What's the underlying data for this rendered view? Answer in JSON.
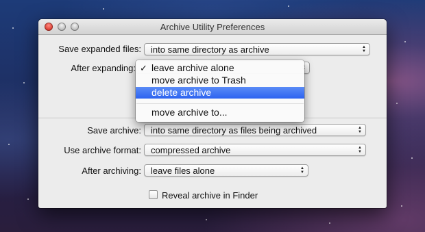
{
  "window": {
    "title": "Archive Utility Preferences"
  },
  "expand": {
    "save_expanded_label": "Save expanded files:",
    "save_expanded_value": "into same directory as archive",
    "after_expanding_label": "After expanding:"
  },
  "menu": {
    "items": [
      {
        "label": "leave archive alone",
        "checked": true,
        "highlighted": false
      },
      {
        "label": "move archive to Trash",
        "checked": false,
        "highlighted": false
      },
      {
        "label": "delete archive",
        "checked": false,
        "highlighted": true
      },
      {
        "label": "move archive to...",
        "checked": false,
        "highlighted": false
      }
    ],
    "check_glyph": "✓"
  },
  "archive": {
    "save_archive_label": "Save archive:",
    "save_archive_value": "into same directory as files being archived",
    "format_label": "Use archive format:",
    "format_value": "compressed archive",
    "after_archiving_label": "After archiving:",
    "after_archiving_value": "leave files alone",
    "reveal_label": "Reveal archive in Finder",
    "reveal_checked": false
  },
  "colors": {
    "highlight": "#2d63f0",
    "close_button": "#d9362b"
  },
  "icons": {
    "popup_arrows": "up-down-arrows-icon"
  }
}
